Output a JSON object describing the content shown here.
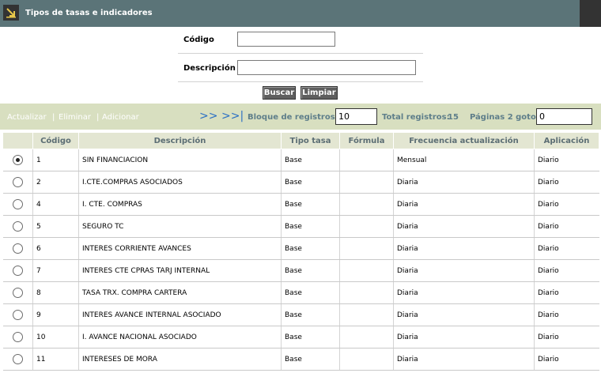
{
  "window": {
    "title": "Tipos de tasas e indicadores"
  },
  "search": {
    "codigo_label": "Código",
    "codigo_value": "",
    "descripcion_label": "Descripción",
    "descripcion_value": "",
    "buscar_label": "Buscar",
    "limpiar_label": "Limpiar"
  },
  "toolbar": {
    "actualizar": "Actualizar",
    "eliminar": "Eliminar",
    "adicionar": "Adicionar",
    "separator": "|",
    "next": ">>",
    "last": ">>|",
    "bloque_label": "Bloque de registros:",
    "bloque_value": "10",
    "total_label": "Total registros:",
    "total_value": "15",
    "paginas_label": "Páginas 2 goto:",
    "goto_value": "0"
  },
  "table": {
    "columns": [
      "",
      "Código",
      "Descripción",
      "Tipo tasa",
      "Fórmula",
      "Frecuencia actualización",
      "Aplicación"
    ],
    "rows": [
      {
        "selected": true,
        "codigo": "1",
        "descripcion": "SIN FINANCIACION",
        "tipo": "Base",
        "formula": "",
        "frecuencia": "Mensual",
        "aplicacion": "Diario"
      },
      {
        "selected": false,
        "codigo": "2",
        "descripcion": "I.CTE.COMPRAS ASOCIADOS",
        "tipo": "Base",
        "formula": "",
        "frecuencia": "Diaria",
        "aplicacion": "Diario"
      },
      {
        "selected": false,
        "codigo": "4",
        "descripcion": "I. CTE. COMPRAS",
        "tipo": "Base",
        "formula": "",
        "frecuencia": "Diaria",
        "aplicacion": "Diario"
      },
      {
        "selected": false,
        "codigo": "5",
        "descripcion": "SEGURO TC",
        "tipo": "Base",
        "formula": "",
        "frecuencia": "Diaria",
        "aplicacion": "Diario"
      },
      {
        "selected": false,
        "codigo": "6",
        "descripcion": "INTERES CORRIENTE AVANCES",
        "tipo": "Base",
        "formula": "",
        "frecuencia": "Diaria",
        "aplicacion": "Diario"
      },
      {
        "selected": false,
        "codigo": "7",
        "descripcion": "INTERES CTE CPRAS TARJ INTERNAL",
        "tipo": "Base",
        "formula": "",
        "frecuencia": "Diaria",
        "aplicacion": "Diario"
      },
      {
        "selected": false,
        "codigo": "8",
        "descripcion": "TASA TRX. COMPRA CARTERA",
        "tipo": "Base",
        "formula": "",
        "frecuencia": "Diaria",
        "aplicacion": "Diario"
      },
      {
        "selected": false,
        "codigo": "9",
        "descripcion": "INTERES AVANCE INTERNAL ASOCIADO",
        "tipo": "Base",
        "formula": "",
        "frecuencia": "Diaria",
        "aplicacion": "Diario"
      },
      {
        "selected": false,
        "codigo": "10",
        "descripcion": "I. AVANCE NACIONAL ASOCIADO",
        "tipo": "Base",
        "formula": "",
        "frecuencia": "Diaria",
        "aplicacion": "Diario"
      },
      {
        "selected": false,
        "codigo": "11",
        "descripcion": "INTERESES DE MORA",
        "tipo": "Base",
        "formula": "",
        "frecuencia": "Diaria",
        "aplicacion": "Diario"
      }
    ]
  },
  "colors": {
    "title_bar": "#5b7478",
    "toolbar_bg": "#d8dfc0",
    "header_bg": "#e3e6d2",
    "arrow_link": "#2a6fc4",
    "button_bg": "#5f5f5f"
  },
  "icons": {
    "title": "expand-arrow-icon",
    "row_select": "radio-icon"
  }
}
